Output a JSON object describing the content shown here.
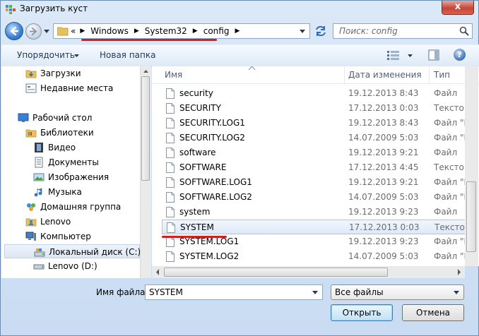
{
  "window": {
    "title": "Загрузить куст",
    "close_glyph": "x"
  },
  "address": {
    "overflow": "«",
    "crumbs": [
      "Windows",
      "System32",
      "config"
    ]
  },
  "search": {
    "placeholder": "Поиск: config"
  },
  "toolbar": {
    "organize": "Упорядочить",
    "new_folder": "Новая папка",
    "help": "?"
  },
  "nav_items": [
    {
      "label": "Загрузки",
      "icon": "downloads-folder-icon"
    },
    {
      "label": "Недавние места",
      "icon": "recent-places-icon"
    },
    {
      "label": "Рабочий стол",
      "icon": "desktop-icon"
    },
    {
      "label": "Библиотеки",
      "icon": "libraries-icon"
    },
    {
      "label": "Видео",
      "icon": "video-library-icon"
    },
    {
      "label": "Документы",
      "icon": "documents-library-icon"
    },
    {
      "label": "Изображения",
      "icon": "pictures-library-icon"
    },
    {
      "label": "Музыка",
      "icon": "music-library-icon"
    },
    {
      "label": "Домашняя группа",
      "icon": "homegroup-icon"
    },
    {
      "label": "Lenovo",
      "icon": "user-folder-icon"
    },
    {
      "label": "Компьютер",
      "icon": "computer-icon"
    },
    {
      "label": "Локальный диск (C:)",
      "icon": "local-disk-icon"
    },
    {
      "label": "Lenovo (D:)",
      "icon": "disk-drive-icon"
    }
  ],
  "columns": {
    "name": "Имя",
    "date": "Дата изменения",
    "type": "Тип"
  },
  "files": [
    {
      "name": "security",
      "date": "19.12.2013 8:43",
      "type": "Файл"
    },
    {
      "name": "SECURITY",
      "date": "17.12.2013 0:03",
      "type": "Текстов"
    },
    {
      "name": "SECURITY.LOG1",
      "date": "19.12.2013 8:43",
      "type": "Файл \"L"
    },
    {
      "name": "SECURITY.LOG2",
      "date": "14.07.2009 5:03",
      "type": "Файл \"L"
    },
    {
      "name": "software",
      "date": "19.12.2013 9:21",
      "type": "Файл"
    },
    {
      "name": "SOFTWARE",
      "date": "17.12.2013 4:45",
      "type": "Текстов"
    },
    {
      "name": "SOFTWARE.LOG1",
      "date": "19.12.2013 9:21",
      "type": "Файл \"L"
    },
    {
      "name": "SOFTWARE.LOG2",
      "date": "14.07.2009 5:03",
      "type": "Файл \"L"
    },
    {
      "name": "system",
      "date": "19.12.2013 9:23",
      "type": "Файл"
    },
    {
      "name": "SYSTEM",
      "date": "17.12.2013 0:03",
      "type": "Текстов"
    },
    {
      "name": "SYSTEM.LOG1",
      "date": "19.12.2013 9:23",
      "type": "Файл \"L"
    },
    {
      "name": "SYSTEM.LOG2",
      "date": "14.07.2009 5:03",
      "type": "Файл \"L"
    }
  ],
  "selected_file": "SYSTEM",
  "bottom": {
    "filename_label": "Имя файла:",
    "filename_value": "SYSTEM",
    "filter_value": "Все файлы",
    "open_label": "Открыть",
    "cancel_label": "Отмена"
  },
  "colors": {
    "annotation": "#d21f1f",
    "selection": "#dde9f8",
    "window_frame": "#c9dcf2"
  }
}
